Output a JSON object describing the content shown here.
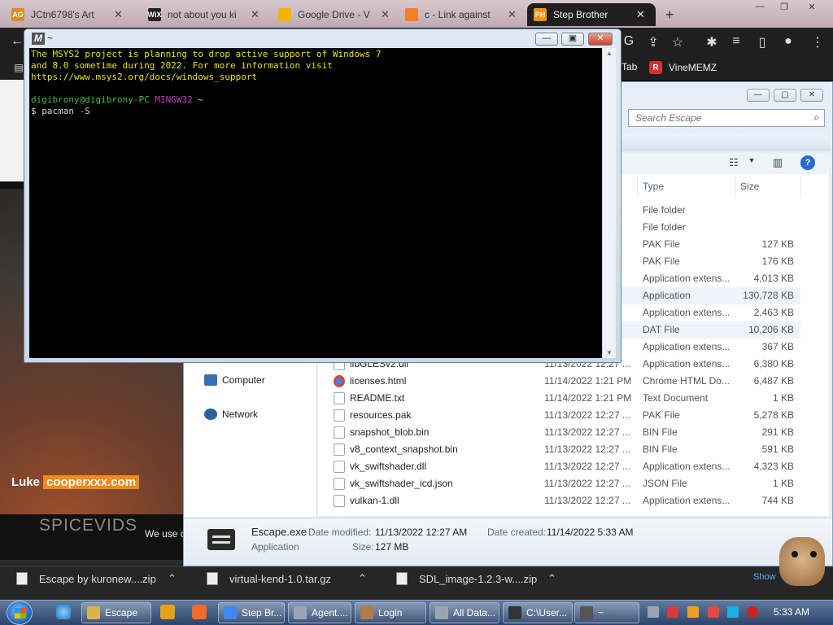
{
  "browser": {
    "tabs": [
      {
        "fav": "AG",
        "label": "JCtn6798's Art",
        "color": "#e08a1c"
      },
      {
        "fav": "WiX",
        "label": "not about you ki",
        "color": "#222222"
      },
      {
        "fav": "",
        "label": "Google Drive - V",
        "color": "#f4b400"
      },
      {
        "fav": "",
        "label": "c - Link against",
        "color": "#f48024"
      },
      {
        "fav": "PH",
        "label": "Step Brother",
        "color": "#ff9000"
      }
    ],
    "bookmarks": [
      {
        "label": "Tab"
      },
      {
        "label": "VineMEMZ"
      }
    ]
  },
  "video": {
    "name": "Luke",
    "site": "cooperxxx.com",
    "brand": "SPICEVIDS",
    "cookie_text": "We use c"
  },
  "terminal": {
    "title": "~",
    "logo": "M",
    "lines": [
      {
        "text": "The MSYS2 project is planning to drop active support of Windows 7",
        "color": "yel"
      },
      {
        "text": "and 8.0 sometime during 2022. For more information visit",
        "color": "yel"
      },
      {
        "text": "https://www.msys2.org/docs/windows_support",
        "color": "yel"
      },
      {
        "text": "",
        "color": "wht"
      },
      {
        "text": "digibrony@digibrony-PC ",
        "color": "grn",
        "extra": "MINGW32",
        "extra2": " ~"
      },
      {
        "text": "$ pacman -S",
        "color": "wht"
      }
    ]
  },
  "explorer": {
    "search_placeholder": "Search Escape",
    "columns": {
      "type": "Type",
      "size": "Size"
    },
    "nav": [
      {
        "label": "Computer"
      },
      {
        "label": "Network"
      }
    ],
    "rows": [
      {
        "name": "",
        "date": "",
        "type": "File folder",
        "size": ""
      },
      {
        "name": "",
        "date": "",
        "type": "File folder",
        "size": ""
      },
      {
        "name": "",
        "date": "",
        "type": "PAK File",
        "size": "127 KB"
      },
      {
        "name": "",
        "date": "",
        "type": "PAK File",
        "size": "176 KB"
      },
      {
        "name": "",
        "date": "",
        "type": "Application extens...",
        "size": "4,013 KB"
      },
      {
        "name": "",
        "date": "",
        "type": "Application",
        "size": "130,728 KB"
      },
      {
        "name": "",
        "date": "",
        "type": "Application extens...",
        "size": "2,463 KB"
      },
      {
        "name": "",
        "date": "",
        "type": "DAT File",
        "size": "10,206 KB"
      },
      {
        "name": "",
        "date": "",
        "type": "Application extens...",
        "size": "367 KB"
      },
      {
        "name": "libGLESv2.dll",
        "date": "11/13/2022 12:27 ...",
        "type": "Application extens...",
        "size": "6,380 KB"
      },
      {
        "name": "licenses.html",
        "date": "11/14/2022 1:21 PM",
        "type": "Chrome HTML Do...",
        "size": "6,487 KB",
        "icon": "chrome"
      },
      {
        "name": "README.txt",
        "date": "11/14/2022 1:21 PM",
        "type": "Text Document",
        "size": "1 KB"
      },
      {
        "name": "resources.pak",
        "date": "11/13/2022 12:27 ...",
        "type": "PAK File",
        "size": "5,278 KB"
      },
      {
        "name": "snapshot_blob.bin",
        "date": "11/13/2022 12:27 ...",
        "type": "BIN File",
        "size": "291 KB"
      },
      {
        "name": "v8_context_snapshot.bin",
        "date": "11/13/2022 12:27 ...",
        "type": "BIN File",
        "size": "591 KB"
      },
      {
        "name": "vk_swiftshader.dll",
        "date": "11/13/2022 12:27 ...",
        "type": "Application extens...",
        "size": "4,323 KB"
      },
      {
        "name": "vk_swiftshader_icd.json",
        "date": "11/13/2022 12:27 ...",
        "type": "JSON File",
        "size": "1 KB"
      },
      {
        "name": "vulkan-1.dll",
        "date": "11/13/2022 12:27 ...",
        "type": "Application extens...",
        "size": "744 KB"
      }
    ],
    "details": {
      "name": "Escape.exe",
      "kind": "Application",
      "modified_label": "Date modified:",
      "modified": "11/13/2022 12:27 AM",
      "created_label": "Date created:",
      "created": "11/14/2022 5:33 AM",
      "size_label": "Size:",
      "size": "127 MB"
    }
  },
  "downloads": [
    {
      "label": "Escape by kuronew....zip"
    },
    {
      "label": "virtual-kend-1.0.tar.gz"
    },
    {
      "label": "SDL_image-1.2.3-w....zip"
    }
  ],
  "show_label": "Show",
  "taskbar": {
    "buttons": [
      {
        "label": "Escape",
        "icon_color": "#d9b44a"
      },
      {
        "label": "Step Br...",
        "icon_color": "#4285f4"
      },
      {
        "label": "Agent....",
        "icon_color": "#9aa6b6"
      },
      {
        "label": "Login",
        "icon_color": "#b07a4a"
      },
      {
        "label": "All Data...",
        "icon_color": "#9aa6b6"
      },
      {
        "label": "C:\\User...",
        "icon_color": "#333333"
      },
      {
        "label": "~",
        "icon_color": "#555555"
      }
    ],
    "clock": "5:33 AM"
  }
}
